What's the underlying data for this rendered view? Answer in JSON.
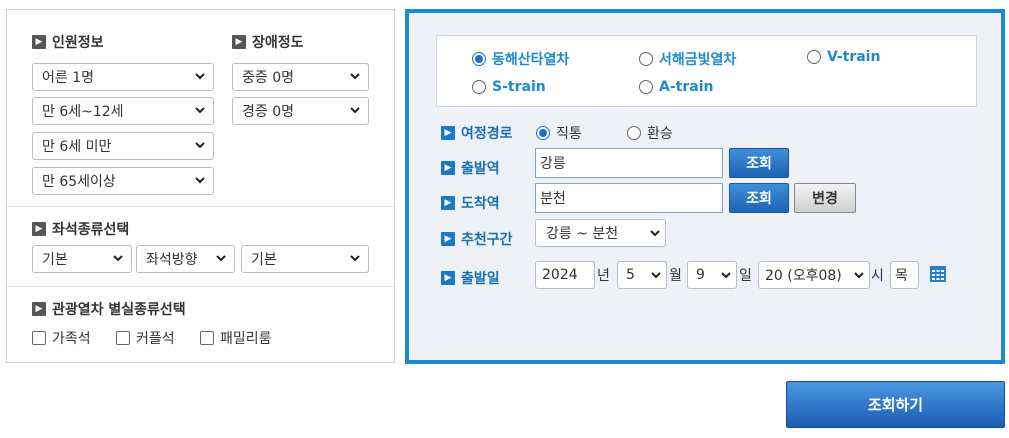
{
  "left": {
    "passenger_title": "인원정보",
    "disability_title": "장애정도",
    "passengers": [
      "어른 1명",
      "만 6세~12세",
      "만 6세 미만",
      "만 65세이상"
    ],
    "disabilities": [
      "중증 0명",
      "경증 0명"
    ],
    "seat_title": "좌석종류선택",
    "seat_options": [
      "기본",
      "좌석방향",
      "기본"
    ],
    "room_title": "관광열차 별실종류선택",
    "rooms": [
      "가족석",
      "커플석",
      "패밀리룸"
    ]
  },
  "right": {
    "trains": [
      {
        "label": "동해산타열차",
        "selected": true
      },
      {
        "label": "서해금빛열차",
        "selected": false
      },
      {
        "label": "V-train",
        "selected": false
      },
      {
        "label": "S-train",
        "selected": false
      },
      {
        "label": "A-train",
        "selected": false
      }
    ],
    "route_label": "여정경로",
    "route_options": [
      {
        "label": "직통",
        "selected": true
      },
      {
        "label": "환승",
        "selected": false
      }
    ],
    "depart_label": "출발역",
    "depart_value": "강릉",
    "arrive_label": "도착역",
    "arrive_value": "분천",
    "lookup_label": "조회",
    "change_label": "변경",
    "recommend_label": "추천구간",
    "recommend_value": "강릉 ~ 분천",
    "date_label": "출발일",
    "year": "2024",
    "year_unit": "년",
    "month": "5",
    "month_unit": "월",
    "day": "9",
    "day_unit": "일",
    "hour": "20 (오후08)",
    "hour_unit": "시",
    "weekday": "목"
  },
  "submit_label": "조회하기",
  "colors": {
    "accent": "#1d8ad0",
    "button": "#1c63b5"
  },
  "icons": [
    "arrow-bullet-icon",
    "chevron-down-icon",
    "calendar-icon"
  ]
}
